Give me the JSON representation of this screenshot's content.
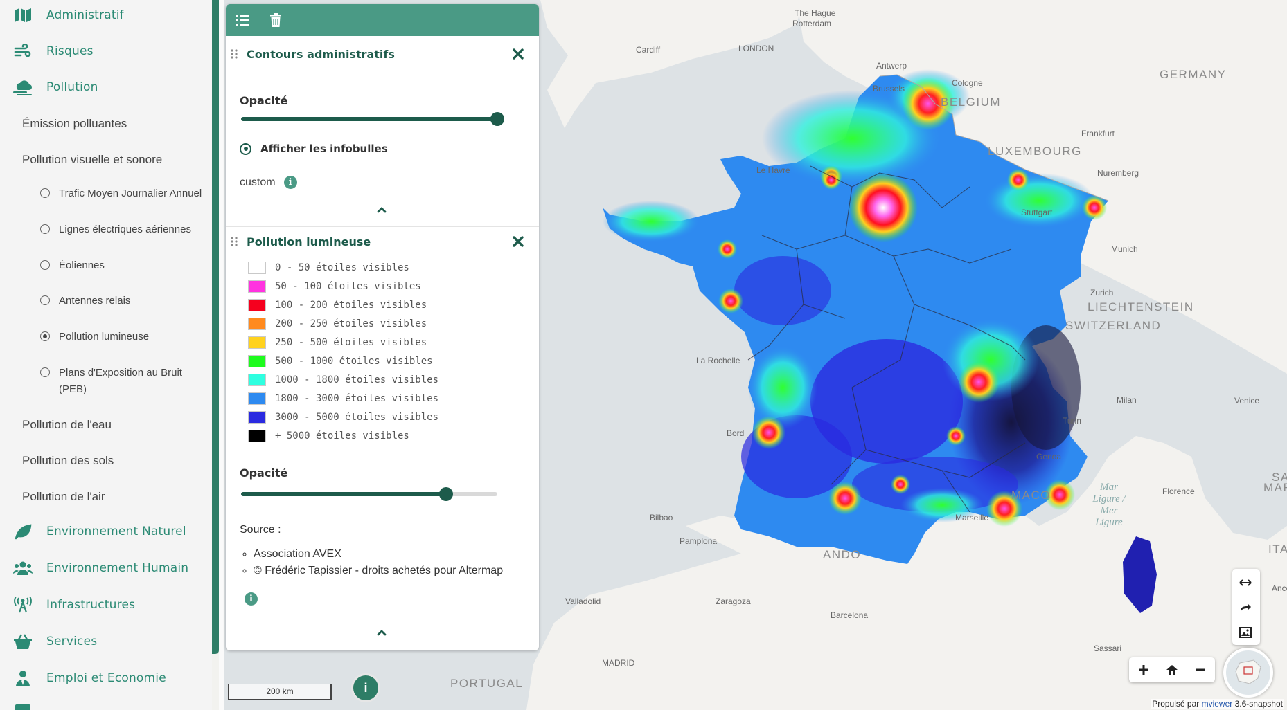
{
  "sidebar": {
    "categories": [
      {
        "label": "Administratif",
        "icon": "map-icon"
      },
      {
        "label": "Risques",
        "icon": "wind-icon"
      },
      {
        "label": "Pollution",
        "icon": "smog-icon"
      },
      {
        "label": "Environnement Naturel",
        "icon": "leaf-icon"
      },
      {
        "label": "Environnement Humain",
        "icon": "users-icon"
      },
      {
        "label": "Infrastructures",
        "icon": "antenna-icon"
      },
      {
        "label": "Services",
        "icon": "basket-icon"
      },
      {
        "label": "Emploi et Economie",
        "icon": "user-tie-icon"
      }
    ],
    "subcategories": {
      "emission": "Émission polluantes",
      "visuelle": "Pollution visuelle et sonore",
      "eau": "Pollution de l'eau",
      "sols": "Pollution des sols",
      "air": "Pollution de l'air"
    },
    "layers": [
      {
        "label": "Trafic Moyen Journalier Annuel",
        "checked": false
      },
      {
        "label": "Lignes électriques aériennes",
        "checked": false
      },
      {
        "label": "Éoliennes",
        "checked": false
      },
      {
        "label": "Antennes relais",
        "checked": false
      },
      {
        "label": "Pollution lumineuse",
        "checked": true
      },
      {
        "label": "Plans d'Exposition au Bruit (PEB)",
        "checked": false
      }
    ]
  },
  "panel": {
    "contours": {
      "title": "Contours administratifs",
      "opacity_label": "Opacité",
      "opacity": 1.0,
      "infobulles_label": "Afficher les infobulles",
      "style_label": "custom"
    },
    "lumineuse": {
      "title": "Pollution lumineuse",
      "opacity_label": "Opacité",
      "opacity": 0.8,
      "legend": [
        {
          "label": "0 - 50 étoiles visibles",
          "color": "#ffffff"
        },
        {
          "label": "50 - 100 étoiles visibles",
          "color": "#ff33e0"
        },
        {
          "label": "100 - 200 étoiles visibles",
          "color": "#f5001e"
        },
        {
          "label": "200 - 250 étoiles visibles",
          "color": "#ff8a1e"
        },
        {
          "label": "250 - 500 étoiles visibles",
          "color": "#ffd21e"
        },
        {
          "label": "500 - 1000 étoiles visibles",
          "color": "#1efb1e"
        },
        {
          "label": "1000 - 1800 étoiles visibles",
          "color": "#2effe0"
        },
        {
          "label": "1800 - 3000 étoiles visibles",
          "color": "#2e8af0"
        },
        {
          "label": "3000 - 5000 étoiles visibles",
          "color": "#2a2ae0"
        },
        {
          "label": "+ 5000 étoiles visibles",
          "color": "#000000"
        }
      ],
      "source_label": "Source :",
      "sources": [
        "Association AVEX",
        "© Frédéric Tapissier - droits achetés pour Altermap"
      ]
    }
  },
  "map": {
    "labels": {
      "countries": [
        "GERMANY",
        "BELGIUM",
        "LUXEMBOURG",
        "LIECHTENSTEIN",
        "SWITZERLAND",
        "PORTUGAL",
        "ANDO",
        "MACO",
        "SAN",
        "MARINO",
        "ITAL"
      ],
      "cities": [
        "The Hague",
        "Rotterdam",
        "LONDON",
        "Cardiff",
        "Antwerp",
        "Brussels",
        "Cologne",
        "Frankfurt",
        "Nuremberg",
        "Stuttgart",
        "Munich",
        "Zurich",
        "Le Havre",
        "La Rochelle",
        "Bord",
        "Turin",
        "Milan",
        "Venice",
        "Genoa",
        "Florence",
        "Bilbao",
        "Pamplona",
        "Marseille",
        "Valladolid",
        "Zaragoza",
        "Barcelona",
        "MADRID",
        "Sassari",
        "Ancona"
      ]
    },
    "sea_label": "Mar Ligure / Mer Ligure",
    "scale_label": "200 km",
    "info_button": "i",
    "attribution_prefix": "Propulsé par",
    "attribution_link": "mviewer",
    "attribution_suffix": "3.6-snapshot"
  }
}
